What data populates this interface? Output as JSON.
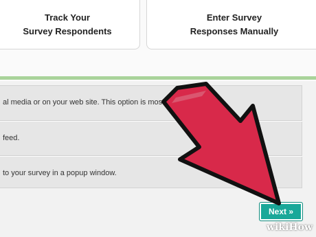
{
  "cards": [
    {
      "line1": "Track Your",
      "line2": "Survey Respondents"
    },
    {
      "line1": "Enter Survey",
      "line2": "Responses Manually"
    }
  ],
  "options": [
    "al media or on your web site. This option is most popular for us.",
    "feed.",
    " to your survey in a popup window."
  ],
  "next_button": {
    "label": "Next »"
  },
  "watermark": {
    "wiki": "wiki",
    "how": "How"
  },
  "colors": {
    "arrow": "#d8294a",
    "accent_line": "#a9d39a",
    "button": "#1aa899"
  }
}
